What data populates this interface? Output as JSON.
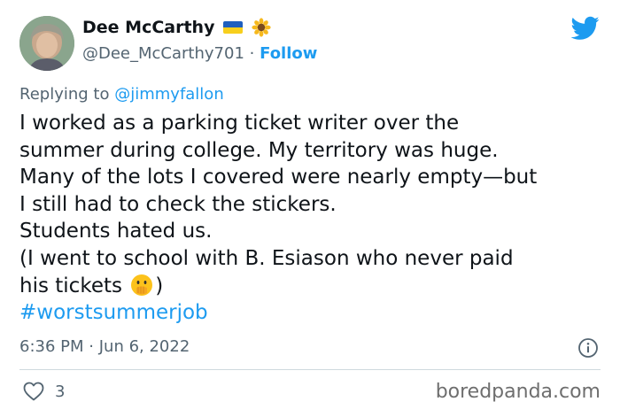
{
  "author": {
    "name": "Dee McCarthy",
    "handle": "@Dee_McCarthy701",
    "separator": "·",
    "follow_label": "Follow"
  },
  "reply": {
    "prefix": "Replying to",
    "mention": "@jimmyfallon"
  },
  "tweet": {
    "lines": [
      "I worked as a parking ticket writer over the",
      "summer during college. My territory was huge.",
      "Many of the lots I covered were nearly empty—but",
      "I still had to check the stickers.",
      "Students hated us.",
      "(I went to school with B. Esiason who never paid"
    ],
    "last_line_before_emoji": "his tickets",
    "last_line_after_emoji": ")",
    "hashtag": "#worstsummerjob"
  },
  "meta": {
    "time": "6:36 PM",
    "separator": "·",
    "date": "Jun 6, 2022"
  },
  "engagement": {
    "likes": "3"
  },
  "watermark": "boredpanda.com",
  "colors": {
    "accent": "#1d9bf0",
    "secondary_text": "#536471",
    "primary_text": "#0f1419"
  },
  "icons": {
    "brand": "twitter-bird-icon",
    "info": "info-icon",
    "like": "heart-icon"
  }
}
